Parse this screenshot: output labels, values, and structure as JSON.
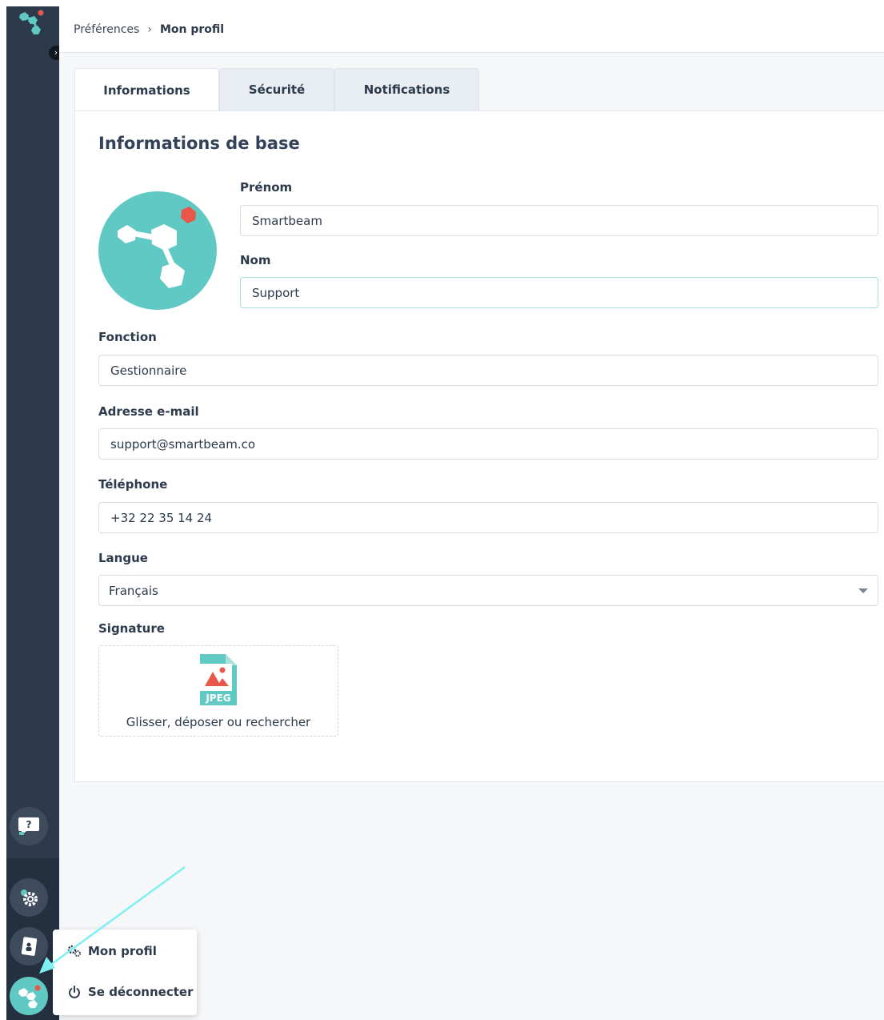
{
  "breadcrumb": {
    "parent": "Préférences",
    "separator": "›",
    "current": "Mon profil"
  },
  "tabs": [
    {
      "label": "Informations",
      "active": true
    },
    {
      "label": "Sécurité",
      "active": false
    },
    {
      "label": "Notifications",
      "active": false
    }
  ],
  "section_title": "Informations de base",
  "fields": {
    "prenom": {
      "label": "Prénom",
      "value": "Smartbeam"
    },
    "nom": {
      "label": "Nom",
      "value": "Support"
    },
    "fonction": {
      "label": "Fonction",
      "value": "Gestionnaire"
    },
    "email": {
      "label": "Adresse e-mail",
      "value": "support@smartbeam.co"
    },
    "telephone": {
      "label": "Téléphone",
      "value": "+32 22 35 14 24"
    },
    "langue": {
      "label": "Langue",
      "value": "Français"
    },
    "signature": {
      "label": "Signature",
      "file_badge": "JPEG",
      "drop_text": "Glisser, déposer ou rechercher"
    }
  },
  "sidebar": {
    "collapse_glyph": "›",
    "help_glyph": "?",
    "icons": [
      "logo-icon",
      "help-icon",
      "gear-icon",
      "contact-card-icon",
      "avatar-icon"
    ]
  },
  "user_menu": {
    "items": [
      {
        "label": "Mon profil",
        "icon": "gears-icon"
      },
      {
        "label": "Se déconnecter",
        "icon": "power-icon"
      }
    ]
  },
  "colors": {
    "sidebar": "#2d3a4b",
    "accent_teal": "#61c9c4",
    "accent_red": "#e8574a",
    "annotation_arrow": "#7ef0f4"
  }
}
